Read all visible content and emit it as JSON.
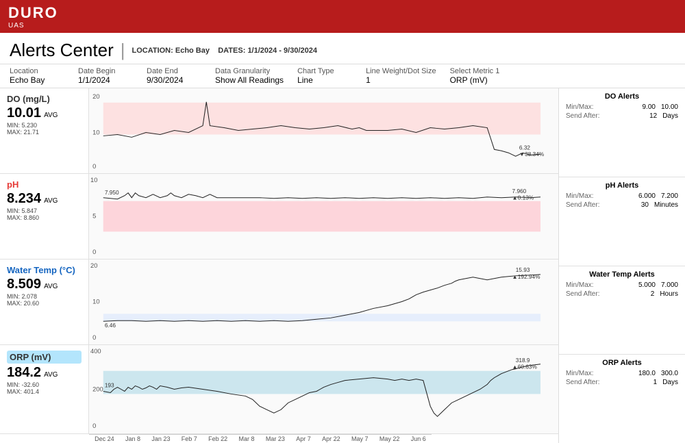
{
  "header": {
    "logo": "DURO",
    "logo_sub": "UAS"
  },
  "title_bar": {
    "title": "Alerts Center",
    "location_label": "LOCATION:",
    "location": "Echo Bay",
    "dates_label": "DATES:",
    "dates": "1/1/2024 - 9/30/2024"
  },
  "controls": [
    {
      "label": "Location",
      "value": "Echo Bay"
    },
    {
      "label": "Date Begin",
      "value": "1/1/2024"
    },
    {
      "label": "Date End",
      "value": "9/30/2024"
    },
    {
      "label": "Data Granularity",
      "value": "Show All Readings"
    },
    {
      "label": "Chart Type",
      "value": "Line"
    },
    {
      "label": "Line Weight/Dot Size",
      "value": "1"
    },
    {
      "label": "Select Metric 1",
      "value": "ORP (mV)"
    }
  ],
  "metrics": [
    {
      "name": "DO (mg/L)",
      "avg": "10.01",
      "avg_label": "AVG",
      "min": "5.230",
      "max": "21.71",
      "color_class": "do-color",
      "band_color": "rgba(255,200,200,0.4)",
      "annotation1": "6.32",
      "annotation2": "38.34%",
      "y_max": "20",
      "y_mid": "10",
      "y_min": "0"
    },
    {
      "name": "pH",
      "avg": "8.234",
      "avg_label": "AVG",
      "min": "5.847",
      "max": "8.860",
      "color_class": "ph-color",
      "band_color": "rgba(255,182,193,0.5)",
      "annotation1": "7.960",
      "annotation2": "0.13%",
      "annotation3": "7.950",
      "y_max": "10",
      "y_mid": "5",
      "y_min": "0"
    },
    {
      "name": "Water Temp (°C)",
      "avg": "8.509",
      "avg_label": "AVG",
      "min": "2.078",
      "max": "20.60",
      "color_class": "wt-color",
      "band_color": "rgba(200,220,255,0.3)",
      "annotation1": "15.93",
      "annotation2": "192.94%",
      "annotation3": "6.46",
      "y_max": "20",
      "y_mid": "10",
      "y_min": "0"
    },
    {
      "name": "ORP (mV)",
      "avg": "184.2",
      "avg_label": "AVG",
      "min": "-32.60",
      "max": "401.4",
      "color_class": "orp-color",
      "band_color": "rgba(173,216,230,0.5)",
      "annotation1": "318.9",
      "annotation2": "60.63%",
      "annotation3": "193",
      "y_max": "400",
      "y_mid": "200",
      "y_min": "0"
    }
  ],
  "alerts": [
    {
      "title": "DO Alerts",
      "min": "9.00",
      "max": "10.00",
      "send_after_value": "12",
      "send_after_unit": "Days"
    },
    {
      "title": "pH Alerts",
      "min": "6.000",
      "max": "7.200",
      "send_after_value": "30",
      "send_after_unit": "Minutes"
    },
    {
      "title": "Water Temp Alerts",
      "min": "5.000",
      "max": "7.000",
      "send_after_value": "2",
      "send_after_unit": "Hours"
    },
    {
      "title": "ORP Alerts",
      "min": "180.0",
      "max": "300.0",
      "send_after_value": "1",
      "send_after_unit": "Days"
    }
  ],
  "x_axis": [
    "Dec 24",
    "Jan 8",
    "Jan 23",
    "Feb 7",
    "Feb 22",
    "Mar 8",
    "Mar 23",
    "Apr 7",
    "Apr 22",
    "May 7",
    "May 22",
    "Jun 6"
  ]
}
